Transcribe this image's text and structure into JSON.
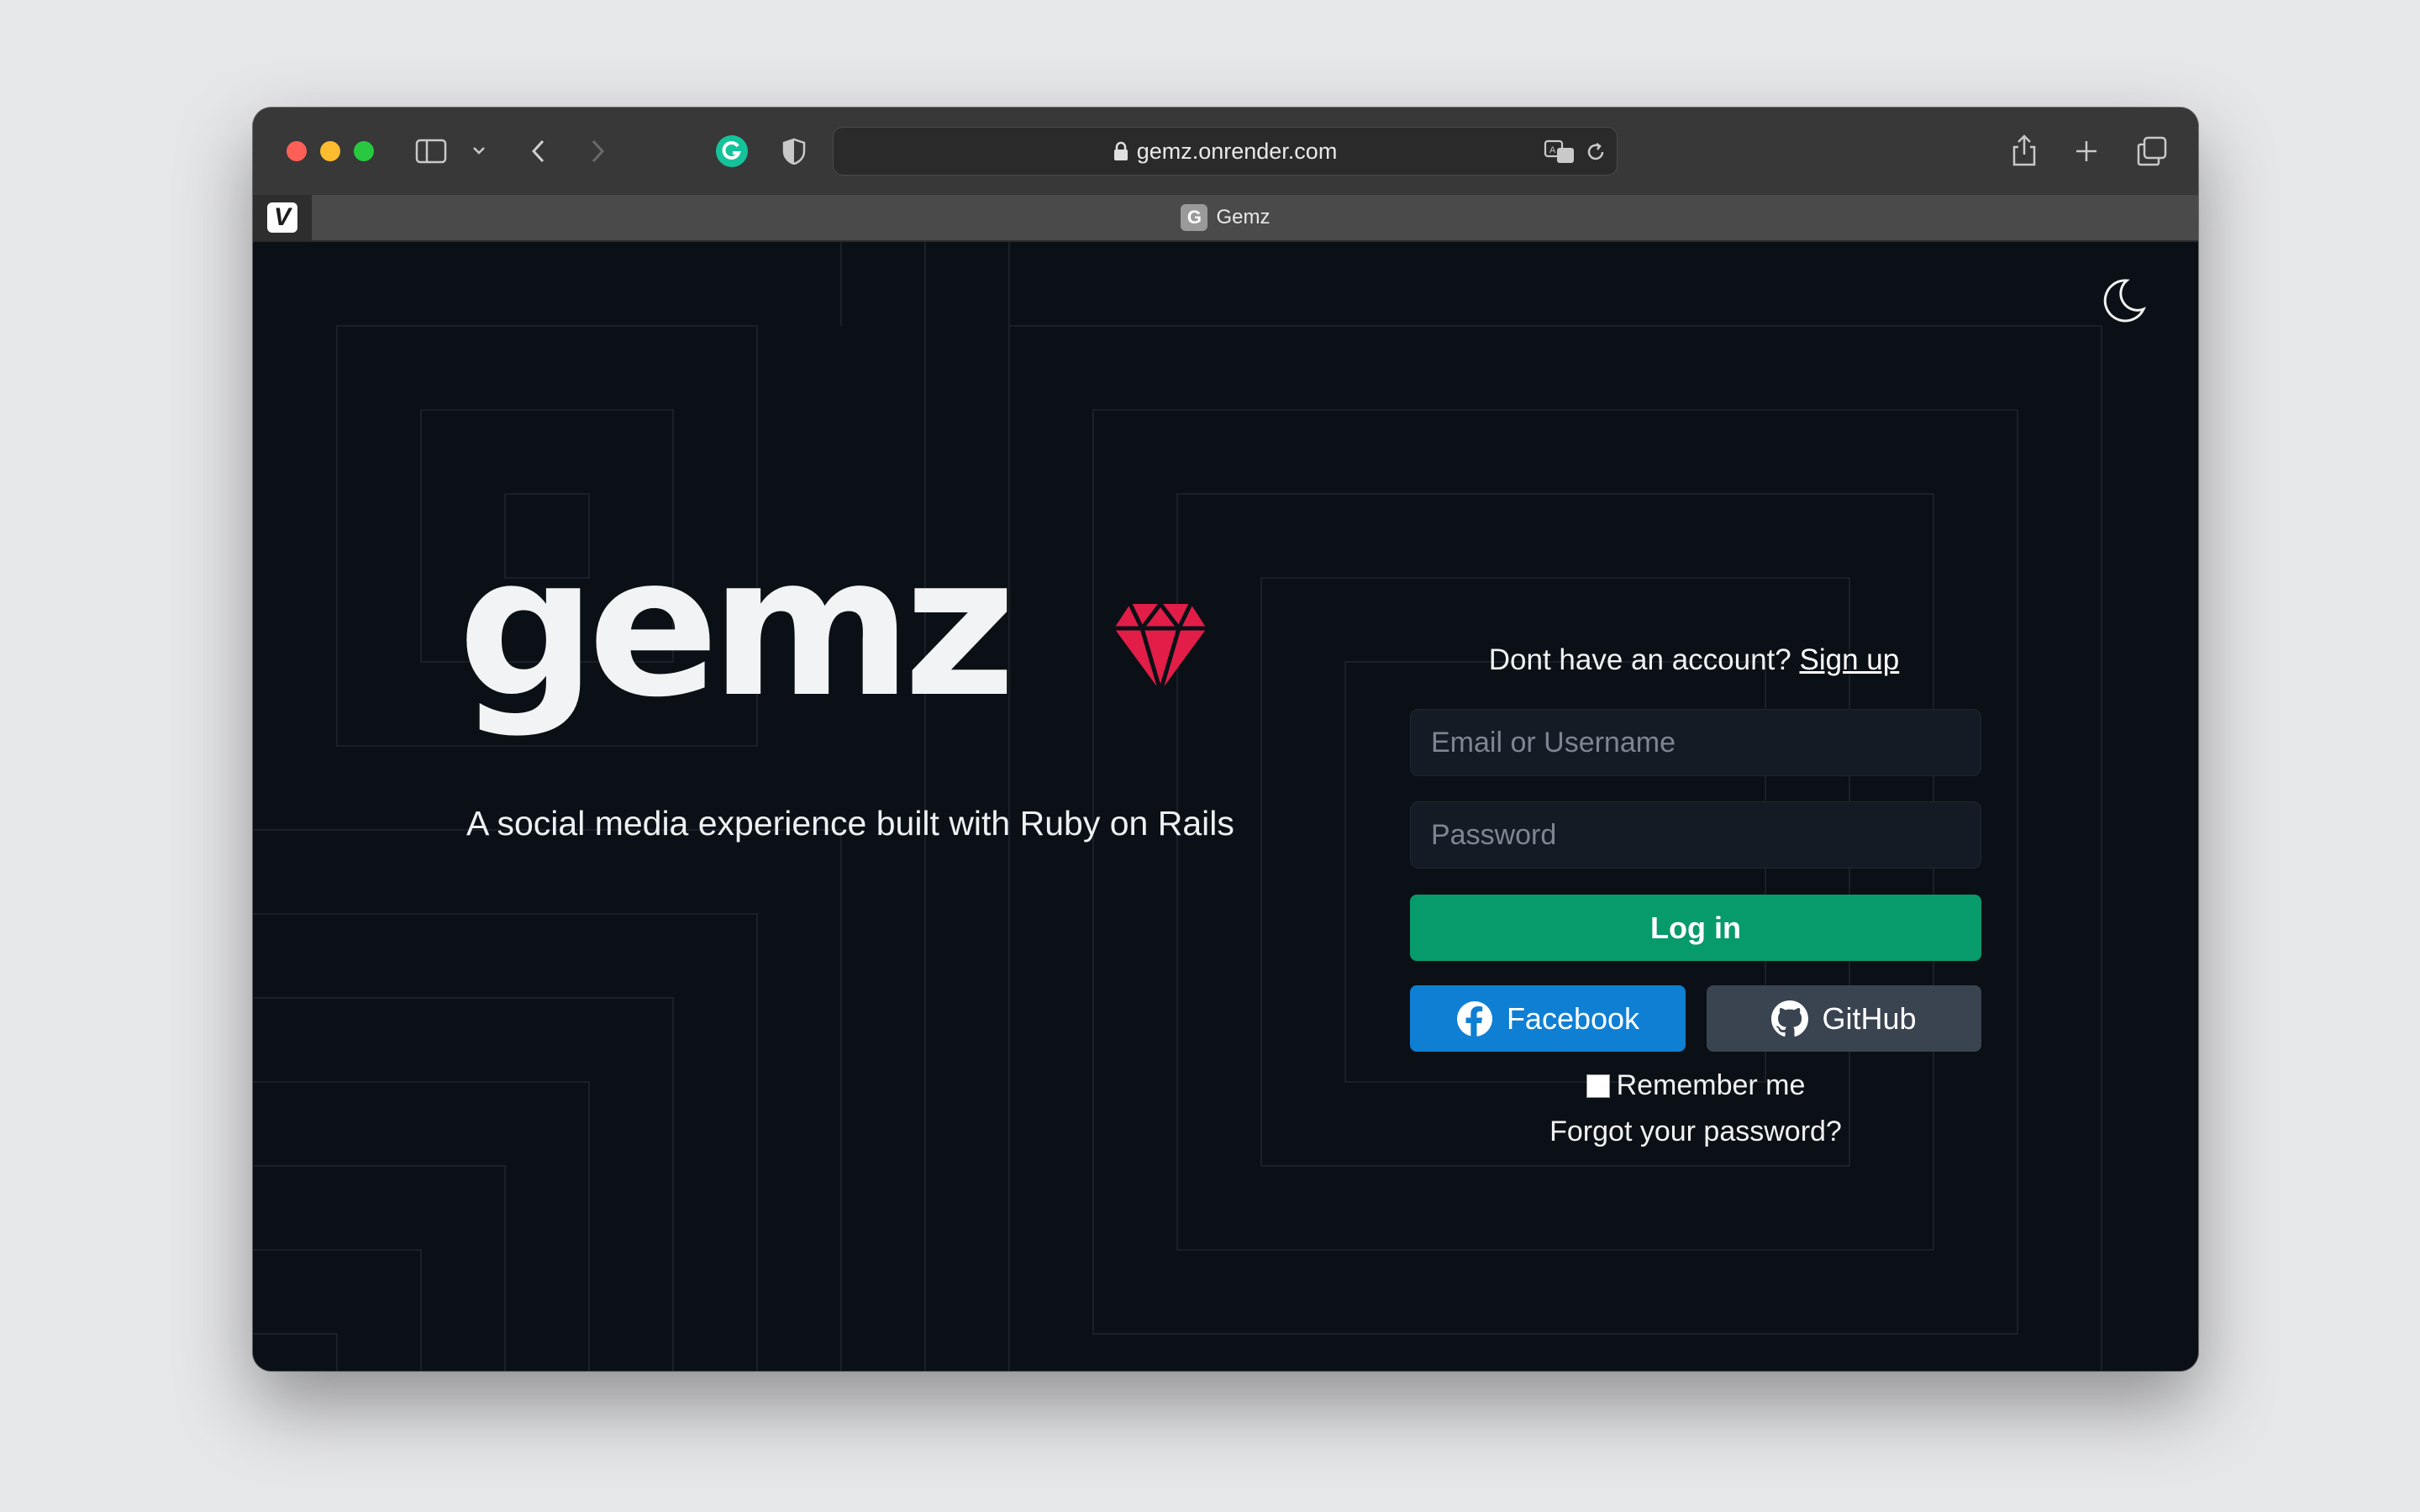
{
  "browser": {
    "url": "gemz.onrender.com",
    "tab_title": "Gemz",
    "tab_favicon_letter": "G",
    "pinned_tab_letter": "V"
  },
  "hero": {
    "logo": "gemz",
    "tagline": "A social media experience built with Ruby on Rails"
  },
  "login": {
    "signup_prompt": "Dont have an account?",
    "signup_link": "Sign up",
    "email_placeholder": "Email or Username",
    "password_placeholder": "Password",
    "login_button": "Log in",
    "facebook_button": "Facebook",
    "github_button": "GitHub",
    "remember_me": "Remember me",
    "forgot_password": "Forgot your password?"
  },
  "colors": {
    "background": "#0b1016",
    "accent_green": "#079a6b",
    "facebook_blue": "#0f7fd4",
    "github_gray": "#3a4350",
    "gem_red": "#e11d48"
  },
  "icons": {
    "theme_toggle": "moon-icon",
    "logo_mark": "gem-icon"
  }
}
